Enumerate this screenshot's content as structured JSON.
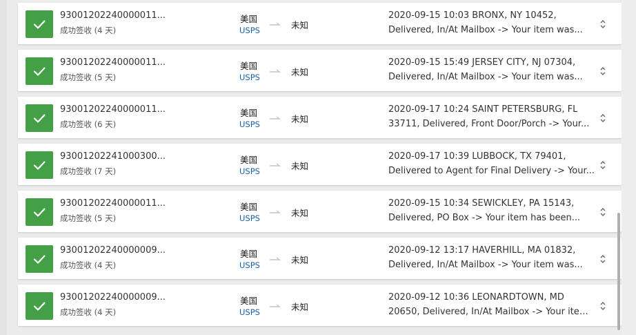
{
  "shipments": [
    {
      "tracking": "93001202240000011...",
      "status": "成功签收 (4 天)",
      "origin": "美国",
      "carrier": "USPS",
      "destination": "未知",
      "event_line1": "2020-09-15 10:03  BRONX, NY 10452,",
      "event_line2": "Delivered, In/At Mailbox -> Your item was..."
    },
    {
      "tracking": "93001202240000011...",
      "status": "成功签收 (5 天)",
      "origin": "美国",
      "carrier": "USPS",
      "destination": "未知",
      "event_line1": "2020-09-15 15:49  JERSEY CITY, NJ 07304,",
      "event_line2": "Delivered, In/At Mailbox -> Your item was..."
    },
    {
      "tracking": "93001202240000011...",
      "status": "成功签收 (6 天)",
      "origin": "美国",
      "carrier": "USPS",
      "destination": "未知",
      "event_line1": "2020-09-17 10:24  SAINT PETERSBURG, FL",
      "event_line2": "33711, Delivered, Front Door/Porch -> Your..."
    },
    {
      "tracking": "93001202241000300...",
      "status": "成功签收 (7 天)",
      "origin": "美国",
      "carrier": "USPS",
      "destination": "未知",
      "event_line1": "2020-09-17 10:39  LUBBOCK, TX 79401,",
      "event_line2": "Delivered to Agent for Final Delivery -> Your..."
    },
    {
      "tracking": "93001202240000011...",
      "status": "成功签收 (5 天)",
      "origin": "美国",
      "carrier": "USPS",
      "destination": "未知",
      "event_line1": "2020-09-15 10:34  SEWICKLEY, PA 15143,",
      "event_line2": "Delivered, PO Box -> Your item has been..."
    },
    {
      "tracking": "93001202240000009...",
      "status": "成功签收 (4 天)",
      "origin": "美国",
      "carrier": "USPS",
      "destination": "未知",
      "event_line1": "2020-09-12 13:17  HAVERHILL, MA 01832,",
      "event_line2": "Delivered, In/At Mailbox -> Your item was..."
    },
    {
      "tracking": "93001202240000009...",
      "status": "成功签收 (4 天)",
      "origin": "美国",
      "carrier": "USPS",
      "destination": "未知",
      "event_line1": "2020-09-12 10:36  LEONARDTOWN, MD",
      "event_line2": "20650, Delivered, In/At Mailbox -> Your item..."
    }
  ],
  "icons": {
    "status": "check-icon",
    "route": "arrow-right-icon",
    "expand": "unfold-more-icon"
  },
  "colors": {
    "delivered": "#43a047",
    "carrier_link": "#1a5fa8"
  }
}
